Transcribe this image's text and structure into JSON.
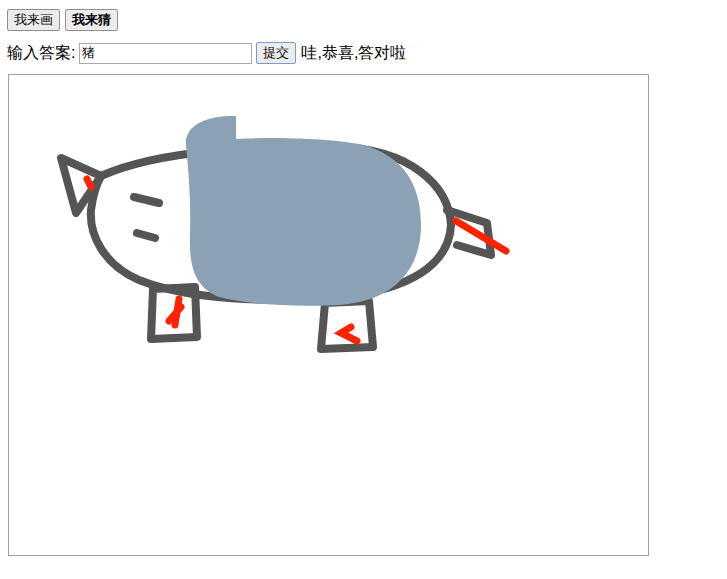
{
  "mode_buttons": [
    {
      "label": "我来画",
      "selected": false
    },
    {
      "label": "我来猜",
      "selected": true
    }
  ],
  "answer": {
    "label": "输入答案:",
    "value": "猪"
  },
  "submit": {
    "label": "提交"
  },
  "message": "哇,恭喜,答对啦"
}
